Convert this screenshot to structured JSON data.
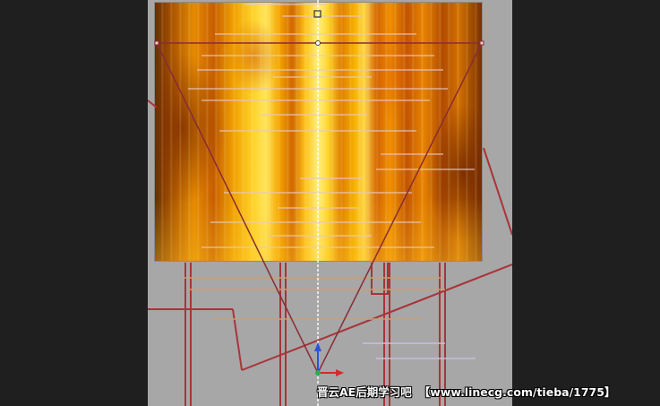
{
  "viewport": {
    "background_color": "#a7a7a7",
    "pasteboard_color": "#1f1f1f",
    "wire_color": "#a8343a",
    "guide_color": "#c9a070",
    "layer_gradient": "fire / golden light streaks"
  },
  "gizmo": {
    "y_axis_color": "#2a54d8",
    "x_axis_color": "#d42a2a",
    "origin_color": "#22b24a"
  },
  "watermark": {
    "title": "晋云AE后期学习吧",
    "url": "【www.linecg.com/tieba/1775】"
  }
}
